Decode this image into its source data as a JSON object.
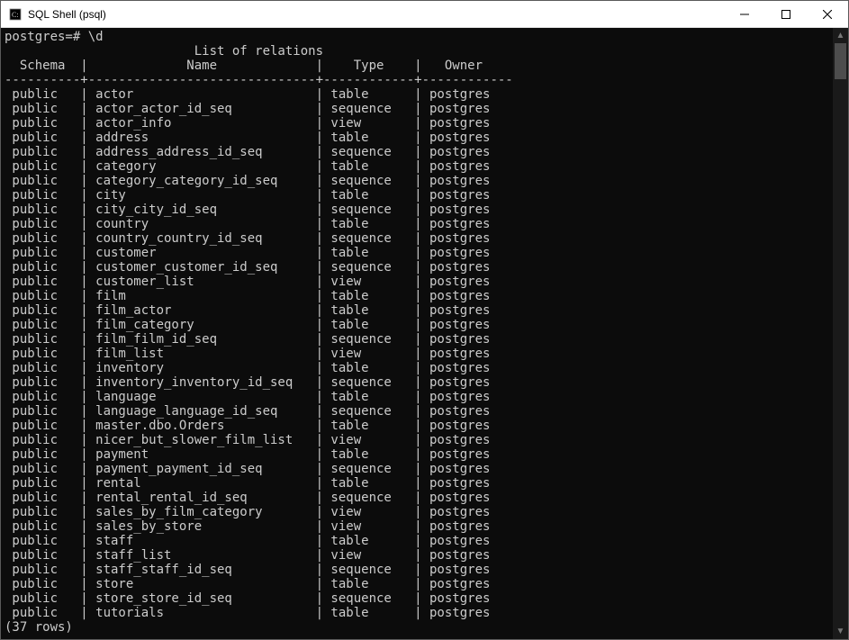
{
  "window": {
    "title": "SQL Shell (psql)"
  },
  "terminal": {
    "prompt": "postgres=# \\d",
    "list_title": "List of relations",
    "headers": {
      "schema": "Schema",
      "name": "Name",
      "type": "Type",
      "owner": "Owner"
    },
    "rows": [
      {
        "schema": "public",
        "name": "actor",
        "type": "table",
        "owner": "postgres"
      },
      {
        "schema": "public",
        "name": "actor_actor_id_seq",
        "type": "sequence",
        "owner": "postgres"
      },
      {
        "schema": "public",
        "name": "actor_info",
        "type": "view",
        "owner": "postgres"
      },
      {
        "schema": "public",
        "name": "address",
        "type": "table",
        "owner": "postgres"
      },
      {
        "schema": "public",
        "name": "address_address_id_seq",
        "type": "sequence",
        "owner": "postgres"
      },
      {
        "schema": "public",
        "name": "category",
        "type": "table",
        "owner": "postgres"
      },
      {
        "schema": "public",
        "name": "category_category_id_seq",
        "type": "sequence",
        "owner": "postgres"
      },
      {
        "schema": "public",
        "name": "city",
        "type": "table",
        "owner": "postgres"
      },
      {
        "schema": "public",
        "name": "city_city_id_seq",
        "type": "sequence",
        "owner": "postgres"
      },
      {
        "schema": "public",
        "name": "country",
        "type": "table",
        "owner": "postgres"
      },
      {
        "schema": "public",
        "name": "country_country_id_seq",
        "type": "sequence",
        "owner": "postgres"
      },
      {
        "schema": "public",
        "name": "customer",
        "type": "table",
        "owner": "postgres"
      },
      {
        "schema": "public",
        "name": "customer_customer_id_seq",
        "type": "sequence",
        "owner": "postgres"
      },
      {
        "schema": "public",
        "name": "customer_list",
        "type": "view",
        "owner": "postgres"
      },
      {
        "schema": "public",
        "name": "film",
        "type": "table",
        "owner": "postgres"
      },
      {
        "schema": "public",
        "name": "film_actor",
        "type": "table",
        "owner": "postgres"
      },
      {
        "schema": "public",
        "name": "film_category",
        "type": "table",
        "owner": "postgres"
      },
      {
        "schema": "public",
        "name": "film_film_id_seq",
        "type": "sequence",
        "owner": "postgres"
      },
      {
        "schema": "public",
        "name": "film_list",
        "type": "view",
        "owner": "postgres"
      },
      {
        "schema": "public",
        "name": "inventory",
        "type": "table",
        "owner": "postgres"
      },
      {
        "schema": "public",
        "name": "inventory_inventory_id_seq",
        "type": "sequence",
        "owner": "postgres"
      },
      {
        "schema": "public",
        "name": "language",
        "type": "table",
        "owner": "postgres"
      },
      {
        "schema": "public",
        "name": "language_language_id_seq",
        "type": "sequence",
        "owner": "postgres"
      },
      {
        "schema": "public",
        "name": "master.dbo.Orders",
        "type": "table",
        "owner": "postgres"
      },
      {
        "schema": "public",
        "name": "nicer_but_slower_film_list",
        "type": "view",
        "owner": "postgres"
      },
      {
        "schema": "public",
        "name": "payment",
        "type": "table",
        "owner": "postgres"
      },
      {
        "schema": "public",
        "name": "payment_payment_id_seq",
        "type": "sequence",
        "owner": "postgres"
      },
      {
        "schema": "public",
        "name": "rental",
        "type": "table",
        "owner": "postgres"
      },
      {
        "schema": "public",
        "name": "rental_rental_id_seq",
        "type": "sequence",
        "owner": "postgres"
      },
      {
        "schema": "public",
        "name": "sales_by_film_category",
        "type": "view",
        "owner": "postgres"
      },
      {
        "schema": "public",
        "name": "sales_by_store",
        "type": "view",
        "owner": "postgres"
      },
      {
        "schema": "public",
        "name": "staff",
        "type": "table",
        "owner": "postgres"
      },
      {
        "schema": "public",
        "name": "staff_list",
        "type": "view",
        "owner": "postgres"
      },
      {
        "schema": "public",
        "name": "staff_staff_id_seq",
        "type": "sequence",
        "owner": "postgres"
      },
      {
        "schema": "public",
        "name": "store",
        "type": "table",
        "owner": "postgres"
      },
      {
        "schema": "public",
        "name": "store_store_id_seq",
        "type": "sequence",
        "owner": "postgres"
      },
      {
        "schema": "public",
        "name": "tutorials",
        "type": "table",
        "owner": "postgres"
      }
    ],
    "footer": "(37 rows)",
    "widths": {
      "schema": 8,
      "name": 28,
      "type": 10,
      "owner": 10
    }
  }
}
